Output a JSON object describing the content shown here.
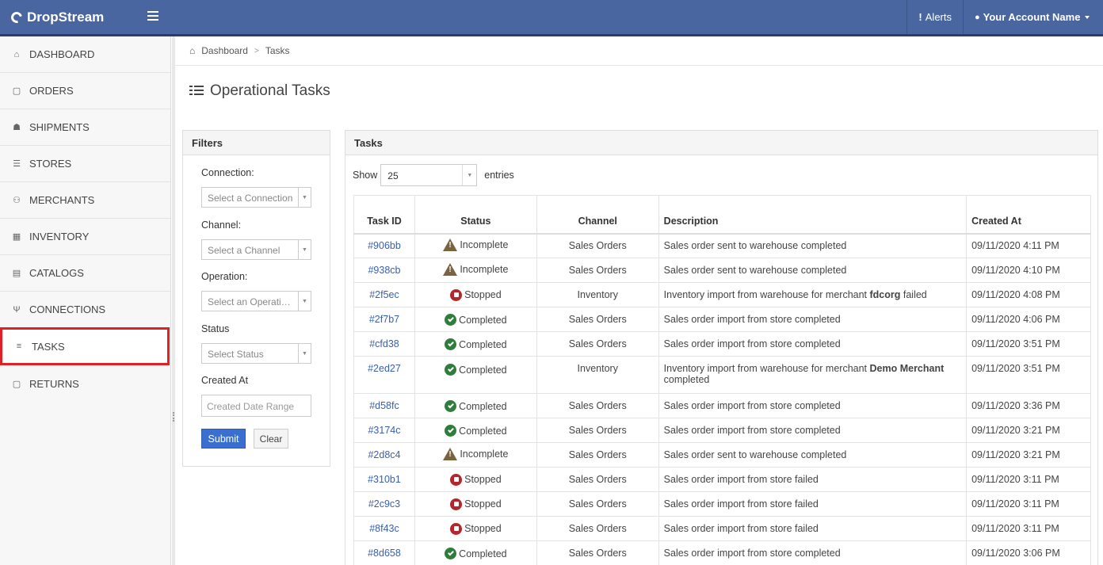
{
  "app": {
    "brand": "DropStream"
  },
  "topbar": {
    "alerts_label": "Alerts",
    "account_label": "Your Account Name"
  },
  "sidebar": {
    "items": [
      {
        "label": "DASHBOARD",
        "icon": "home-icon"
      },
      {
        "label": "ORDERS",
        "icon": "bag-icon"
      },
      {
        "label": "SHIPMENTS",
        "icon": "gift-icon"
      },
      {
        "label": "STORES",
        "icon": "cart-icon"
      },
      {
        "label": "MERCHANTS",
        "icon": "users-icon"
      },
      {
        "label": "INVENTORY",
        "icon": "warehouse-icon"
      },
      {
        "label": "CATALOGS",
        "icon": "book-icon"
      },
      {
        "label": "CONNECTIONS",
        "icon": "plug-icon"
      },
      {
        "label": "TASKS",
        "icon": "list-icon",
        "active": true
      },
      {
        "label": "RETURNS",
        "icon": "bag-icon"
      }
    ]
  },
  "breadcrumb": {
    "home": "Dashboard",
    "current": "Tasks"
  },
  "page": {
    "title": "Operational Tasks"
  },
  "filters": {
    "title": "Filters",
    "connection_label": "Connection:",
    "connection_placeholder": "Select a Connection",
    "channel_label": "Channel:",
    "channel_placeholder": "Select a Channel",
    "operation_label": "Operation:",
    "operation_placeholder": "Select an Operati…",
    "status_label": "Status",
    "status_placeholder": "Select Status",
    "created_label": "Created At",
    "created_placeholder": "Created Date Range",
    "submit_label": "Submit",
    "clear_label": "Clear"
  },
  "tasks": {
    "title": "Tasks",
    "show_label": "Show",
    "page_length": "25",
    "entries_label": "entries",
    "columns": {
      "id": "Task ID",
      "status": "Status",
      "channel": "Channel",
      "description": "Description",
      "created": "Created At"
    },
    "rows": [
      {
        "id": "#906bb",
        "status": "Incomplete",
        "status_type": "warning",
        "channel": "Sales Orders",
        "desc": "Sales order sent to warehouse completed",
        "desc_bold": "",
        "desc_after": "",
        "created": "09/11/2020 4:11 PM"
      },
      {
        "id": "#938cb",
        "status": "Incomplete",
        "status_type": "warning",
        "channel": "Sales Orders",
        "desc": "Sales order sent to warehouse completed",
        "desc_bold": "",
        "desc_after": "",
        "created": "09/11/2020 4:10 PM"
      },
      {
        "id": "#2f5ec",
        "status": "Stopped",
        "status_type": "stopped",
        "channel": "Inventory",
        "desc": "Inventory import from warehouse for merchant ",
        "desc_bold": "fdcorg",
        "desc_after": " failed",
        "created": "09/11/2020 4:08 PM"
      },
      {
        "id": "#2f7b7",
        "status": "Completed",
        "status_type": "ok",
        "channel": "Sales Orders",
        "desc": "Sales order import from store completed",
        "desc_bold": "",
        "desc_after": "",
        "created": "09/11/2020 4:06 PM"
      },
      {
        "id": "#cfd38",
        "status": "Completed",
        "status_type": "ok",
        "channel": "Sales Orders",
        "desc": "Sales order import from store completed",
        "desc_bold": "",
        "desc_after": "",
        "created": "09/11/2020 3:51 PM"
      },
      {
        "id": "#2ed27",
        "status": "Completed",
        "status_type": "ok",
        "channel": "Inventory",
        "desc": "Inventory import from warehouse for merchant ",
        "desc_bold": "Demo Merchant",
        "desc_after": " completed",
        "created": "09/11/2020 3:51 PM",
        "tall": true
      },
      {
        "id": "#d58fc",
        "status": "Completed",
        "status_type": "ok",
        "channel": "Sales Orders",
        "desc": "Sales order import from store completed",
        "desc_bold": "",
        "desc_after": "",
        "created": "09/11/2020 3:36 PM"
      },
      {
        "id": "#3174c",
        "status": "Completed",
        "status_type": "ok",
        "channel": "Sales Orders",
        "desc": "Sales order import from store completed",
        "desc_bold": "",
        "desc_after": "",
        "created": "09/11/2020 3:21 PM"
      },
      {
        "id": "#2d8c4",
        "status": "Incomplete",
        "status_type": "warning",
        "channel": "Sales Orders",
        "desc": "Sales order sent to warehouse completed",
        "desc_bold": "",
        "desc_after": "",
        "created": "09/11/2020 3:21 PM"
      },
      {
        "id": "#310b1",
        "status": "Stopped",
        "status_type": "stopped",
        "channel": "Sales Orders",
        "desc": "Sales order import from store failed",
        "desc_bold": "",
        "desc_after": "",
        "created": "09/11/2020 3:11 PM"
      },
      {
        "id": "#2c9c3",
        "status": "Stopped",
        "status_type": "stopped",
        "channel": "Sales Orders",
        "desc": "Sales order import from store failed",
        "desc_bold": "",
        "desc_after": "",
        "created": "09/11/2020 3:11 PM"
      },
      {
        "id": "#8f43c",
        "status": "Stopped",
        "status_type": "stopped",
        "channel": "Sales Orders",
        "desc": "Sales order import from store failed",
        "desc_bold": "",
        "desc_after": "",
        "created": "09/11/2020 3:11 PM"
      },
      {
        "id": "#8d658",
        "status": "Completed",
        "status_type": "ok",
        "channel": "Sales Orders",
        "desc": "Sales order import from store completed",
        "desc_bold": "",
        "desc_after": "",
        "created": "09/11/2020 3:06 PM"
      }
    ]
  },
  "colors": {
    "topbar": "#4a66a0",
    "active_outline": "#e02027",
    "link": "#3a5fae",
    "submit": "#3a6ecf",
    "ok": "#2f7d3a",
    "stopped": "#b3262c",
    "warning": "#7a6340"
  }
}
